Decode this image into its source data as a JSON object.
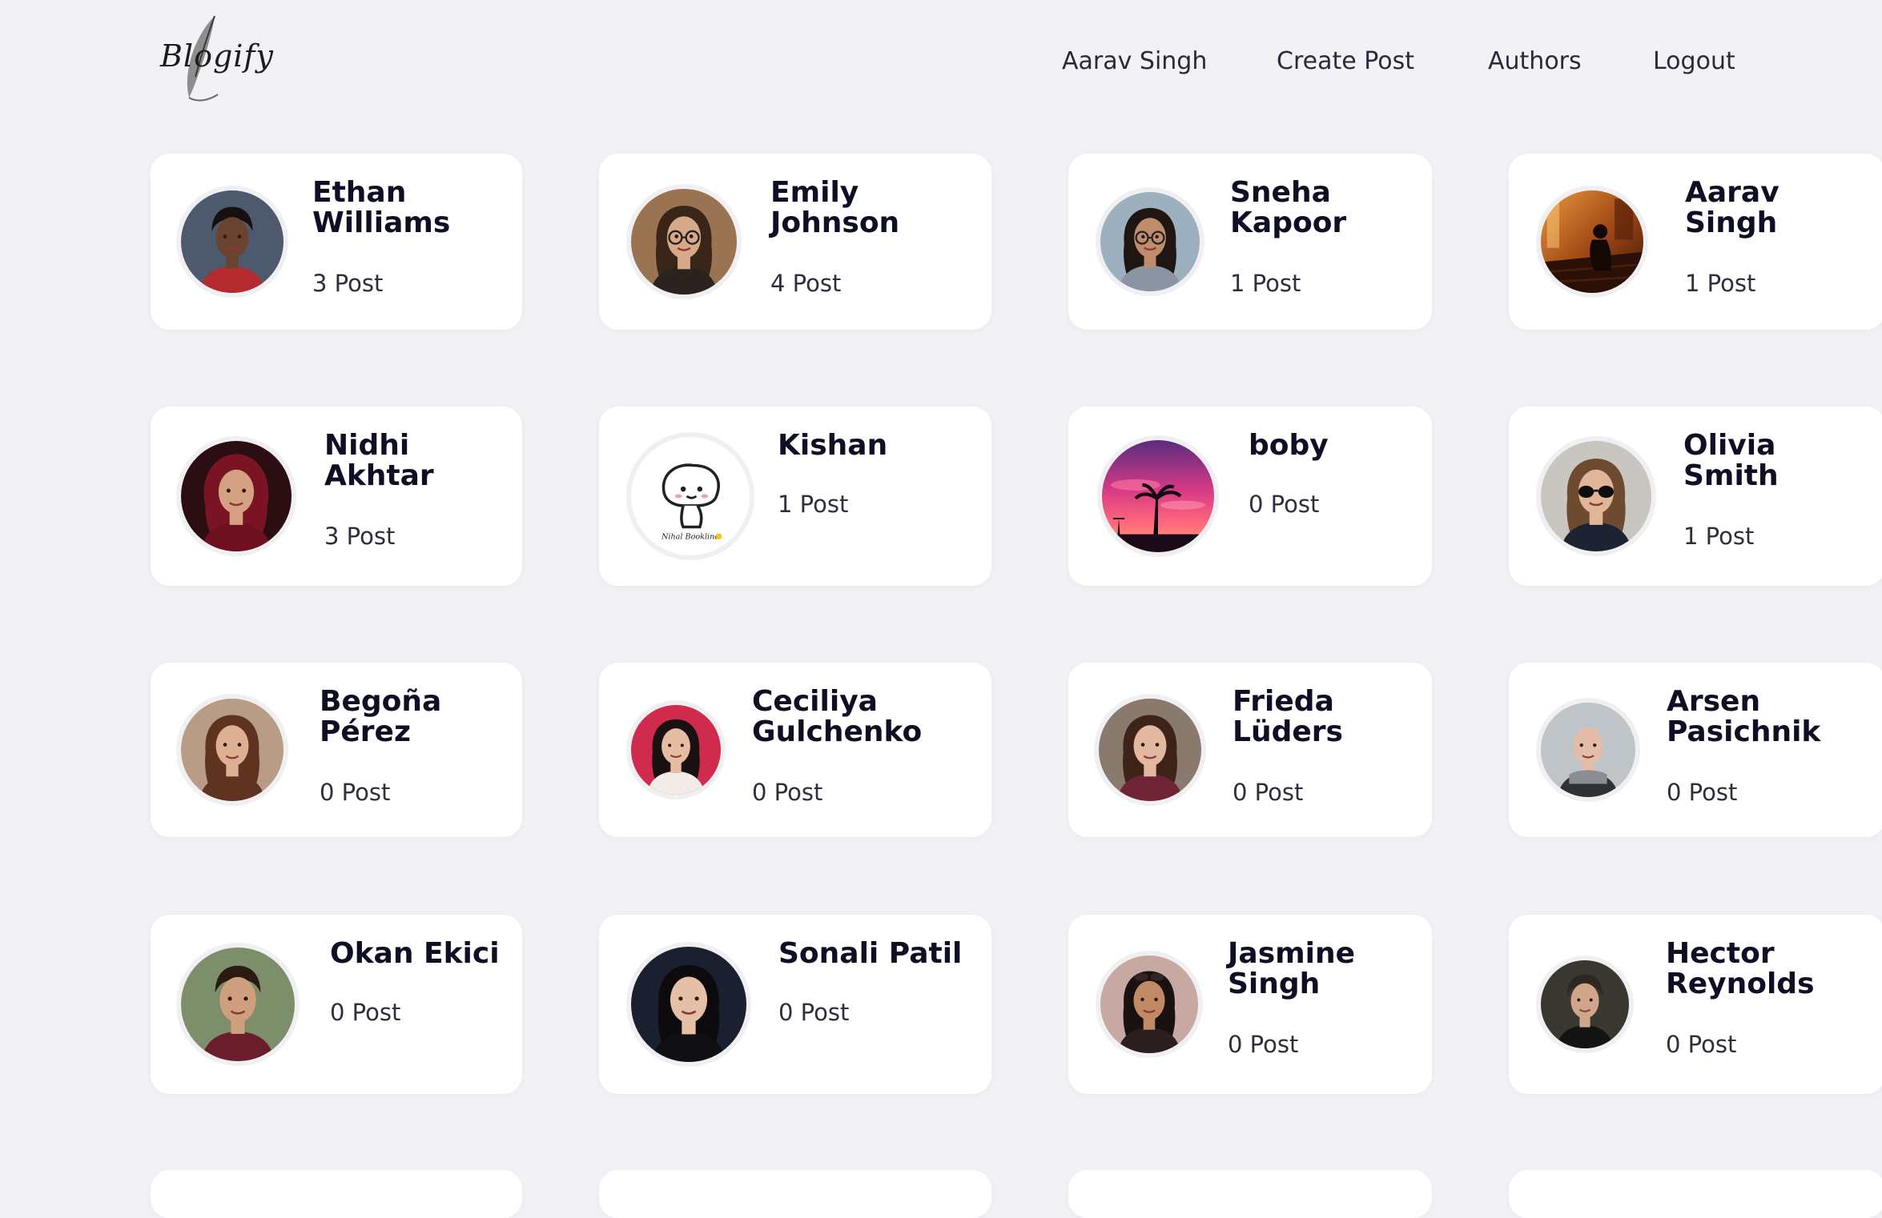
{
  "brand": {
    "logo_text": "Blogify",
    "logo_subtitle": "BLOGIFY"
  },
  "nav": {
    "user": "Aarav Singh",
    "create_post": "Create Post",
    "authors": "Authors",
    "logout": "Logout"
  },
  "authors": [
    {
      "name_line1": "Ethan",
      "name_line2": "Williams",
      "posts": "3 Post",
      "avatar": "photo-young-man-curly-hair",
      "bg": "#4d5a6e",
      "skin": "#6b4430",
      "hair": "#161010",
      "shirt": "#b52a2e"
    },
    {
      "name_line1": "Emily",
      "name_line2": "Johnson",
      "posts": "4 Post",
      "avatar": "photo-woman-glasses",
      "bg": "#9a7452",
      "skin": "#d8a888",
      "hair": "#3a2618",
      "shirt": "#2a2320"
    },
    {
      "name_line1": "Sneha",
      "name_line2": "Kapoor",
      "posts": "1 Post",
      "avatar": "photo-woman-smiling",
      "bg": "#9db0c0",
      "skin": "#c08d6c",
      "hair": "#1f1612",
      "shirt": "#8a94a2"
    },
    {
      "name_line1": "Aarav",
      "name_line2": "Singh",
      "posts": "1 Post",
      "avatar": "photo-silhouette-steps",
      "bg": "#a9531c",
      "skin": "#1c0f08",
      "hair": "#120904",
      "shirt": "#2a1508"
    },
    {
      "name_line1": "Nidhi",
      "name_line2": "Akhtar",
      "posts": "3 Post",
      "avatar": "photo-woman-hijab",
      "bg": "#2a0e12",
      "skin": "#d4a183",
      "hair": "#7a1425",
      "shirt": "#6e1020"
    },
    {
      "name_line1": "Kishan",
      "name_line2": "",
      "posts": "1 Post",
      "avatar": "cartoon-mushroom",
      "bg": "#ffffff",
      "skin": "#ffffff",
      "hair": "#ffffff",
      "shirt": "#ffffff"
    },
    {
      "name_line1": "boby",
      "name_line2": "",
      "posts": "0 Post",
      "avatar": "photo-sunset-palm",
      "bg": "#b8306a",
      "skin": "#111111",
      "hair": "#111111",
      "shirt": "#111111"
    },
    {
      "name_line1": "Olivia",
      "name_line2": "Smith",
      "posts": "1 Post",
      "avatar": "photo-woman-sunglasses",
      "bg": "#c9c6c2",
      "skin": "#e0b598",
      "hair": "#6e4a2e",
      "shirt": "#1d2333"
    },
    {
      "name_line1": "Begoña",
      "name_line2": "Pérez",
      "posts": "0 Post",
      "avatar": "photo-woman-curly-hair",
      "bg": "#b89c86",
      "skin": "#ddb093",
      "hair": "#5e3320",
      "shirt": "#5e3320"
    },
    {
      "name_line1": "Ceciliya",
      "name_line2": "Gulchenko",
      "posts": "0 Post",
      "avatar": "photo-woman-pink-background",
      "bg": "#d02a4c",
      "skin": "#e6bca2",
      "hair": "#1a1212",
      "shirt": "#f1ece8"
    },
    {
      "name_line1": "Frieda",
      "name_line2": "Lüders",
      "posts": "0 Post",
      "avatar": "photo-woman-brown-hair",
      "bg": "#8a7a6e",
      "skin": "#e2b8a0",
      "hair": "#3e2418",
      "shirt": "#6e2436"
    },
    {
      "name_line1": "Arsen",
      "name_line2": "Pasichnik",
      "posts": "0 Post",
      "avatar": "photo-bald-man-scarf",
      "bg": "#bfc4c8",
      "skin": "#e4bda8",
      "hair": "#e4bda8",
      "shirt": "#2f3134"
    },
    {
      "name_line1": "Okan Ekici",
      "name_line2": "",
      "posts": "0 Post",
      "avatar": "photo-young-man-outdoor",
      "bg": "#7c8f6a",
      "skin": "#cf9f7e",
      "hair": "#2a1a12",
      "shirt": "#6a1e2c"
    },
    {
      "name_line1": "Sonali Patil",
      "name_line2": "",
      "posts": "0 Post",
      "avatar": "photo-woman-dark-background",
      "bg": "#1a2030",
      "skin": "#e6c0a6",
      "hair": "#0c0a0c",
      "shirt": "#0f0f14"
    },
    {
      "name_line1": "Jasmine",
      "name_line2": "Singh",
      "posts": "0 Post",
      "avatar": "photo-woman-sunglasses-on-head",
      "bg": "#c7a8a2",
      "skin": "#c18a66",
      "hair": "#1a1210",
      "shirt": "#2a1e1e"
    },
    {
      "name_line1": "Hector",
      "name_line2": "Reynolds",
      "posts": "0 Post",
      "avatar": "photo-man-suit",
      "bg": "#3a3630",
      "skin": "#d1a688",
      "hair": "#2e2620",
      "shirt": "#141414"
    }
  ]
}
